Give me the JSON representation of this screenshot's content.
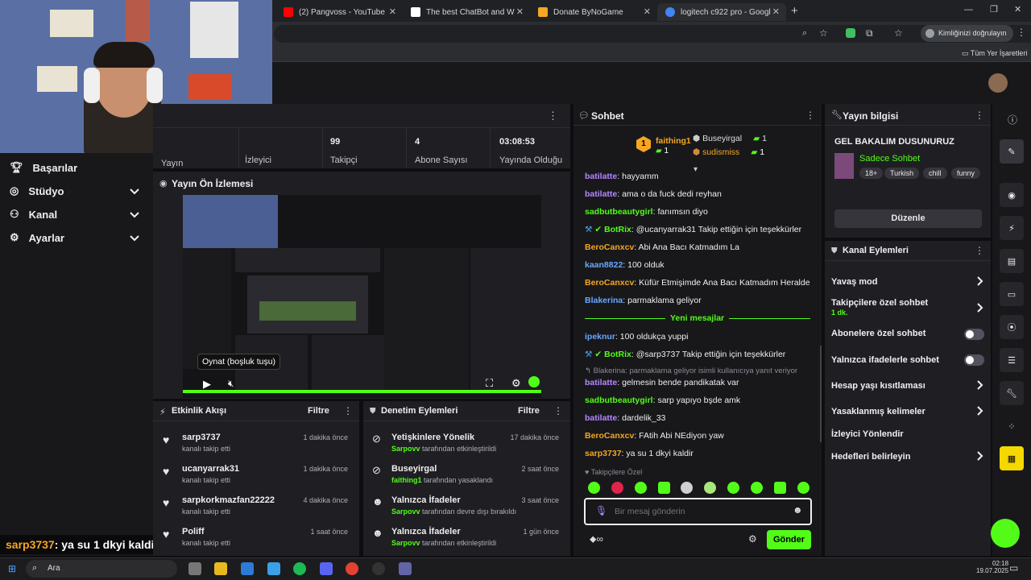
{
  "browser": {
    "tabs": [
      {
        "title": "(2) Pangvoss - YouTube",
        "color": "#ff0000"
      },
      {
        "title": "The best ChatBot and Widgets",
        "color": "#ffffff"
      },
      {
        "title": "Donate ByNoGame",
        "color": "#f5a623"
      },
      {
        "title": "logitech c922 pro - Google Alış",
        "color": "#4285f4"
      }
    ],
    "verify_label": "Kimliğinizi doğrulayın",
    "bookmarks_label": "Tüm Yer İşaretleri"
  },
  "stats": [
    {
      "value": "",
      "label": "Yayın"
    },
    {
      "value": "",
      "label": "İzleyici"
    },
    {
      "value": "99",
      "label": "Takipçi"
    },
    {
      "value": "4",
      "label": "Abone Sayısı"
    },
    {
      "value": "03:08:53",
      "label": "Yayında Olduğu"
    }
  ],
  "nav": [
    {
      "label": "Başarılar",
      "icon": "trophy-icon"
    },
    {
      "label": "Stüdyo",
      "icon": "studio-icon"
    },
    {
      "label": "Kanal",
      "icon": "channel-icon"
    },
    {
      "label": "Ayarlar",
      "icon": "gear-icon"
    }
  ],
  "preview": {
    "title": "Yayın Ön İzlemesi",
    "tooltip": "Oynat (boşluk tuşu)"
  },
  "overlay_chat": {
    "user": "sarp3737",
    "text": ": ya su 1 dkyi kaldir"
  },
  "activity": {
    "title": "Etkinlik Akışı",
    "filter": "Filtre",
    "items": [
      {
        "name": "sarp3737",
        "sub": "kanalı takip etti",
        "time": "1 dakika önce"
      },
      {
        "name": "ucanyarrak31",
        "sub": "kanalı takip etti",
        "time": "1 dakika önce"
      },
      {
        "name": "sarpkorkmazfan22222",
        "sub": "kanalı takip etti",
        "time": "4 dakika önce"
      },
      {
        "name": "Poliff",
        "sub": "kanalı takip etti",
        "time": "1 saat önce"
      }
    ]
  },
  "moderation": {
    "title": "Denetim Eylemleri",
    "filter": "Filtre",
    "items": [
      {
        "name": "Yetişkinlere Yönelik",
        "actor": "Sarpovv",
        "sub": " tarafından etkinleştirildi",
        "time": "17 dakika önce"
      },
      {
        "name": "Buseyirgal",
        "actor": "faithing1",
        "sub": " tarafından yasaklandı",
        "time": "2 saat önce"
      },
      {
        "name": "Yalnızca İfadeler",
        "actor": "Sarpovv",
        "sub": " tarafından devre dışı bırakıldı",
        "time": "3 saat önce"
      },
      {
        "name": "Yalnızca İfadeler",
        "actor": "Sarpovv",
        "sub": " tarafından etkinleştirildi",
        "time": "1 gün önce"
      }
    ]
  },
  "chat": {
    "title": "Sohbet",
    "leaders": [
      {
        "rank": "1",
        "name": "faithing1",
        "count": "1"
      },
      {
        "name": "Buseyirgal",
        "count": "1"
      },
      {
        "name": "sudismiss",
        "count": "1"
      }
    ],
    "messages": [
      {
        "user": "batilatte",
        "color": "#b388ff",
        "text": ": hayyamm"
      },
      {
        "user": "batilatte",
        "color": "#b388ff",
        "text": ": ama o da fuck dedi reyhan"
      },
      {
        "user": "sadbutbeautygirl",
        "color": "#53fc18",
        "text": ": fanımsın diyo"
      },
      {
        "user": "BotRix",
        "color": "#53fc18",
        "text": ": @ucanyarrak31 Takip ettiğin için teşekkürler"
      },
      {
        "user": "BeroCanxcv",
        "color": "#f5a623",
        "text": ": Abi Ana Bacı Katmadım La"
      },
      {
        "user": "kaan8822",
        "color": "#6aa7ff",
        "text": ": 100 olduk"
      },
      {
        "user": "BeroCanxcv",
        "color": "#f5a623",
        "text": ": Küfür Etmişimde Ana Bacı Katmadım Heralde"
      },
      {
        "user": "Blakerina",
        "color": "#6aa7ff",
        "text": ": parmaklama geliyor"
      }
    ],
    "new_label": "Yeni mesajlar",
    "messages2": [
      {
        "user": "ipeknur",
        "color": "#6aa7ff",
        "text": ": 100 oldukça yuppi"
      },
      {
        "user": "BotRix",
        "color": "#53fc18",
        "text": ": @sarp3737 Takip ettiğin için teşekkürler"
      },
      {
        "user": "batilatte",
        "color": "#b388ff",
        "text": ": gelmesin bende pandikatak var"
      },
      {
        "user": "sadbutbeautygirl",
        "color": "#53fc18",
        "text": ": sarp yapıyo bşde amk"
      },
      {
        "user": "batilatte",
        "color": "#b388ff",
        "text": ": dardelik_33"
      },
      {
        "user": "BeroCanxcv",
        "color": "#f5a623",
        "text": ": FAtih Abi NEdiyon yaw"
      },
      {
        "user": "sarp3737",
        "color": "#f5a623",
        "text": ": ya su 1 dkyi kaldir"
      }
    ],
    "reply_note": "Blakerina: parmaklama geliyor isimli kullanıcıya yanıt veriyor",
    "followers_only": "Takipçilere Özel",
    "placeholder": "Bir mesaj gönderin",
    "send": "Gönder"
  },
  "stream_info": {
    "title": "Yayın bilgisi",
    "stream_title": "GEL BAKALIM DUSUNURUZ",
    "category": "Sadece Sohbet",
    "tags": [
      "18+",
      "Turkish",
      "chill",
      "funny"
    ],
    "edit": "Düzenle"
  },
  "channel_actions": {
    "title": "Kanal Eylemleri",
    "items": [
      {
        "label": "Yavaş mod",
        "type": "arrow"
      },
      {
        "label": "Takipçilere özel sohbet",
        "sub": "1 dk.",
        "type": "arrow"
      },
      {
        "label": "Abonelere özel sohbet",
        "type": "toggle"
      },
      {
        "label": "Yalnızca ifadelerle sohbet",
        "type": "toggle"
      },
      {
        "label": "Hesap yaşı kısıtlaması",
        "type": "arrow"
      },
      {
        "label": "Yasaklanmış kelimeler",
        "type": "arrow"
      },
      {
        "label": "İzleyici Yönlendir",
        "type": "none"
      },
      {
        "label": "Hedefleri belirleyin",
        "type": "arrow"
      }
    ]
  },
  "taskbar": {
    "search": "Ara",
    "time": "02:18",
    "date": "19.07.2025"
  },
  "colors": {
    "accent": "#53fc18",
    "panel": "#1f1f23",
    "bg": "#0e0e10"
  }
}
